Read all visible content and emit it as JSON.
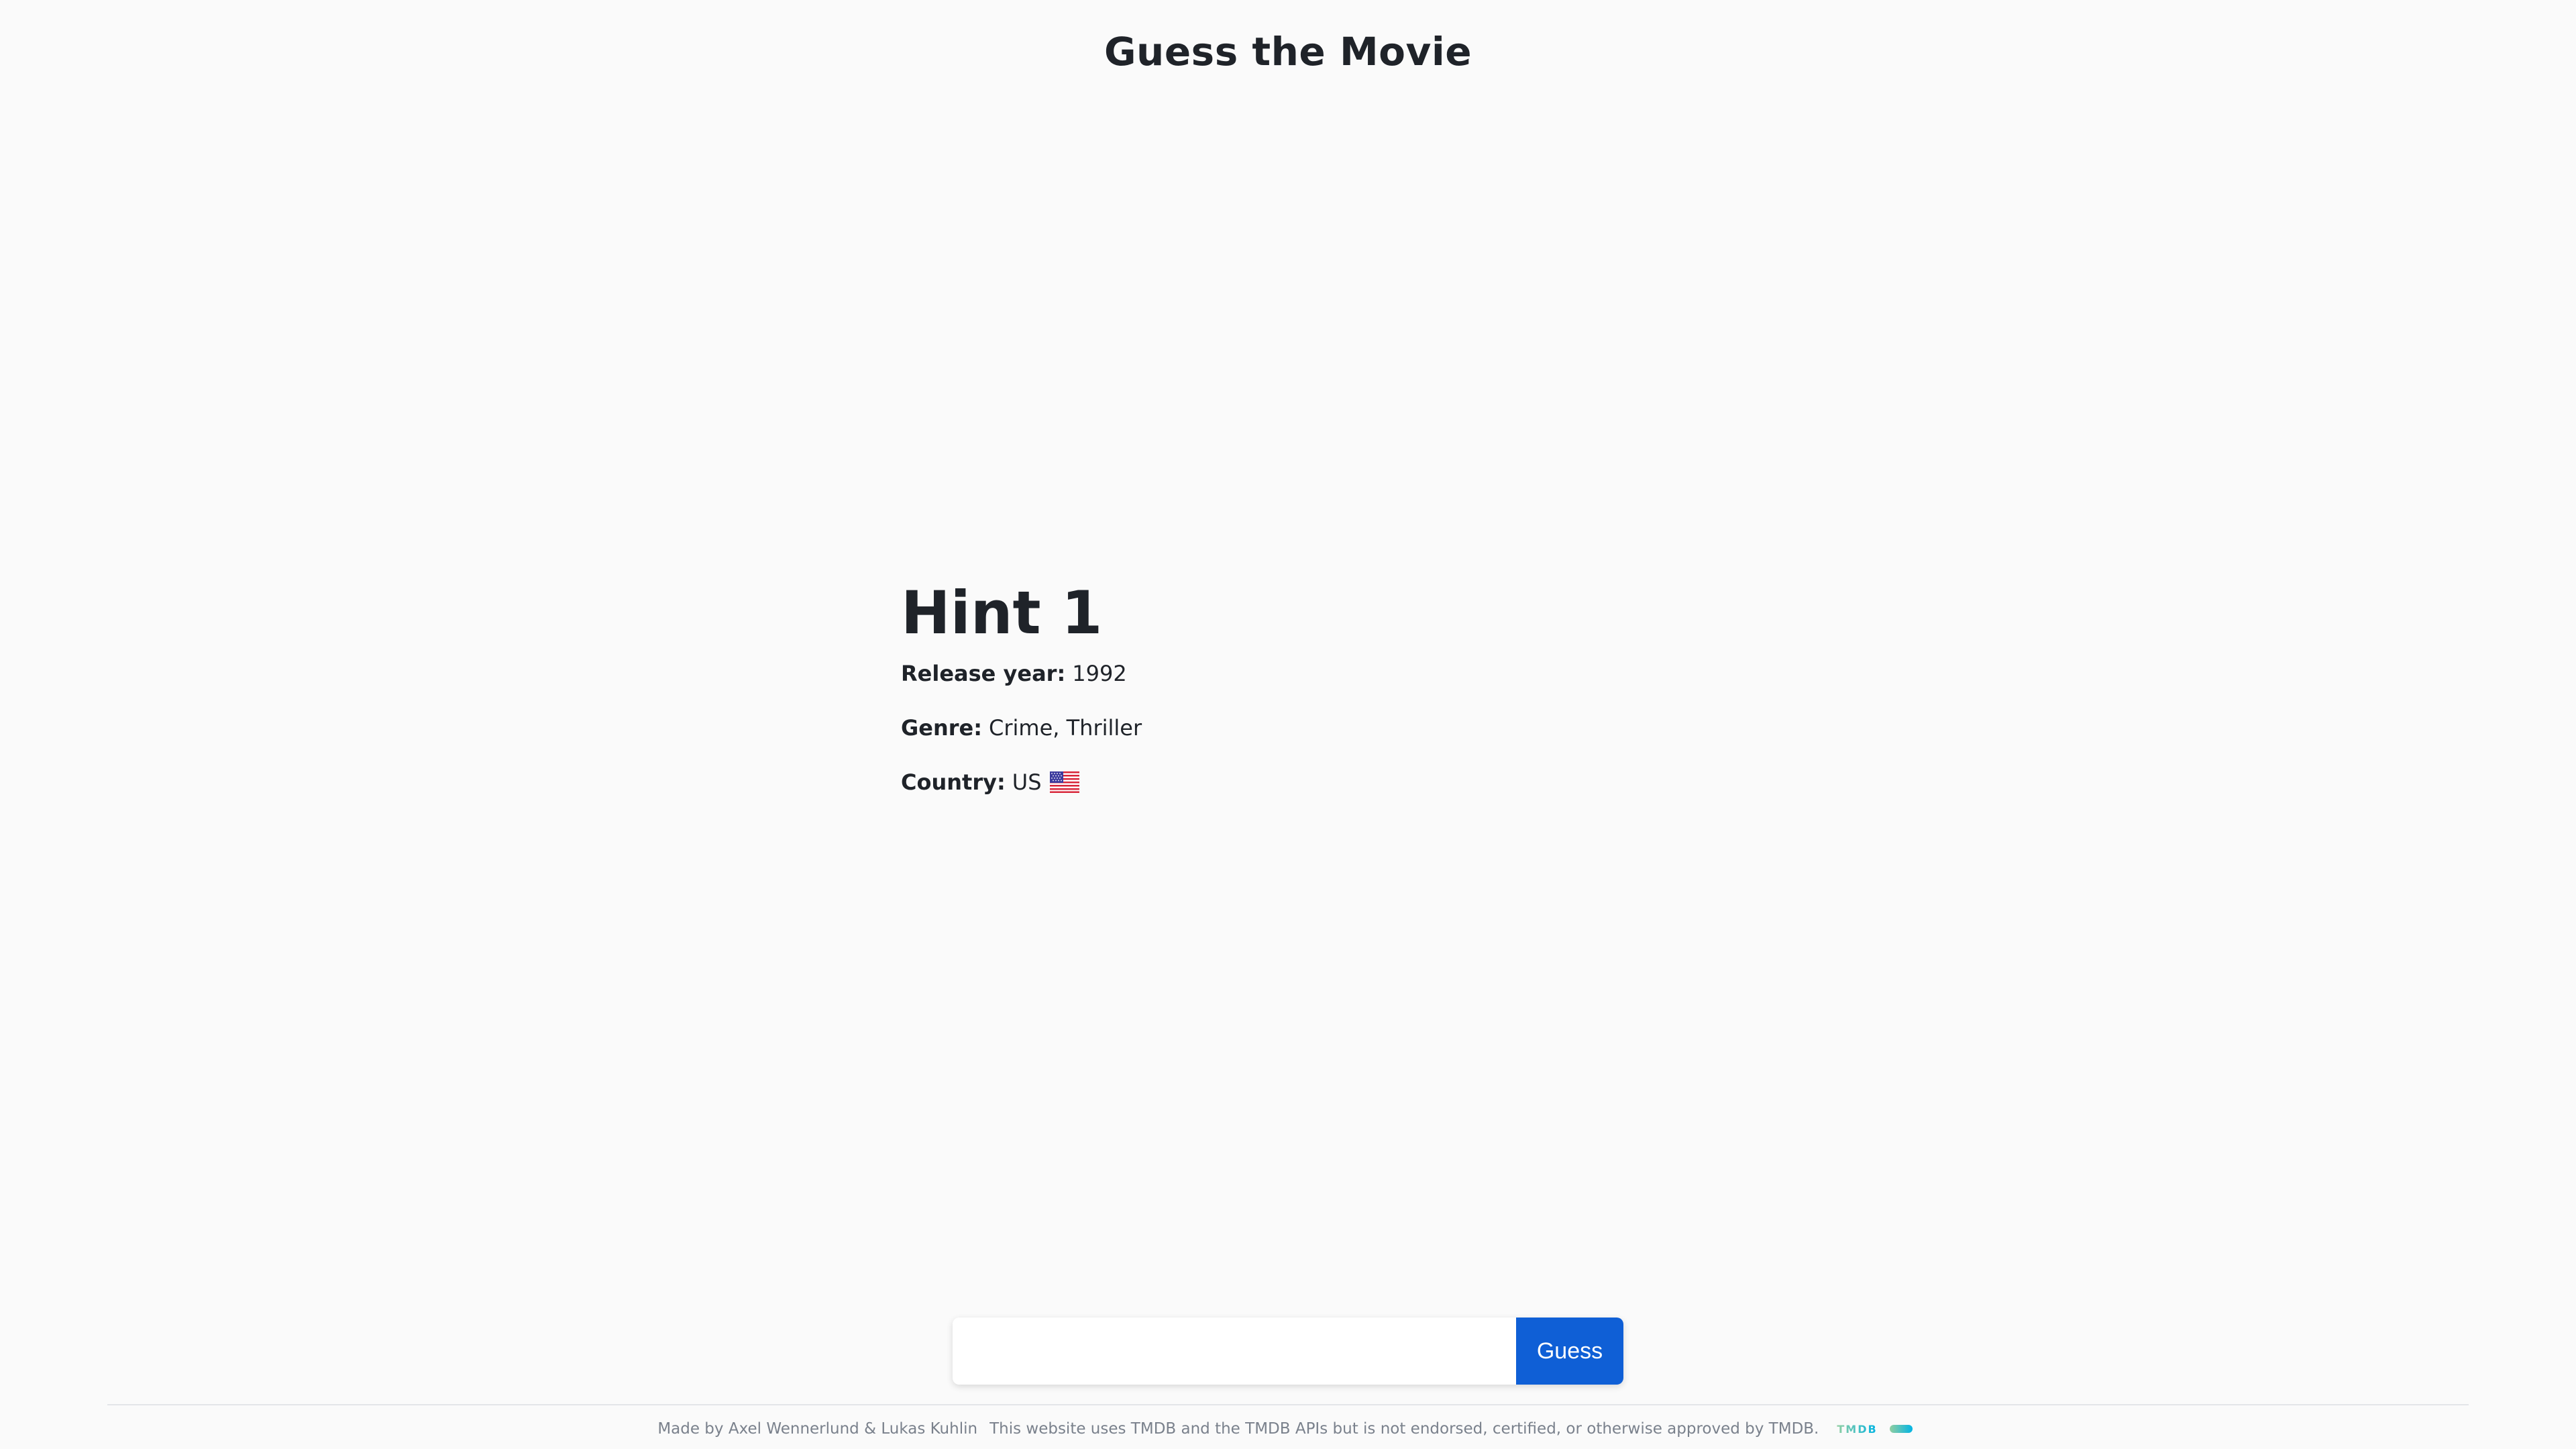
{
  "header": {
    "title": "Guess the Movie"
  },
  "hint": {
    "title": "Hint 1",
    "rows": [
      {
        "label": "Release year:",
        "value": "1992"
      },
      {
        "label": "Genre:",
        "value": "Crime, Thriller"
      },
      {
        "label": "Country:",
        "value": "US",
        "icon": "us-flag-icon"
      }
    ]
  },
  "guess_form": {
    "input_value": "",
    "input_placeholder": "",
    "button_label": "Guess"
  },
  "footer": {
    "credits": "Made by Axel Wennerlund & Lukas Kuhlin",
    "disclaimer": "This website uses TMDB and the TMDB APIs but is not endorsed, certified, or otherwise approved by TMDB.",
    "logo_text": "TMDB",
    "logo_icon": "tmdb-logo-icon"
  },
  "colors": {
    "background": "#fafafa",
    "text": "#1f2329",
    "button": "#0f5fd6",
    "footer_text": "#7a818c",
    "tmdb_gradient_start": "#90cea1",
    "tmdb_gradient_end": "#01b4e4"
  }
}
